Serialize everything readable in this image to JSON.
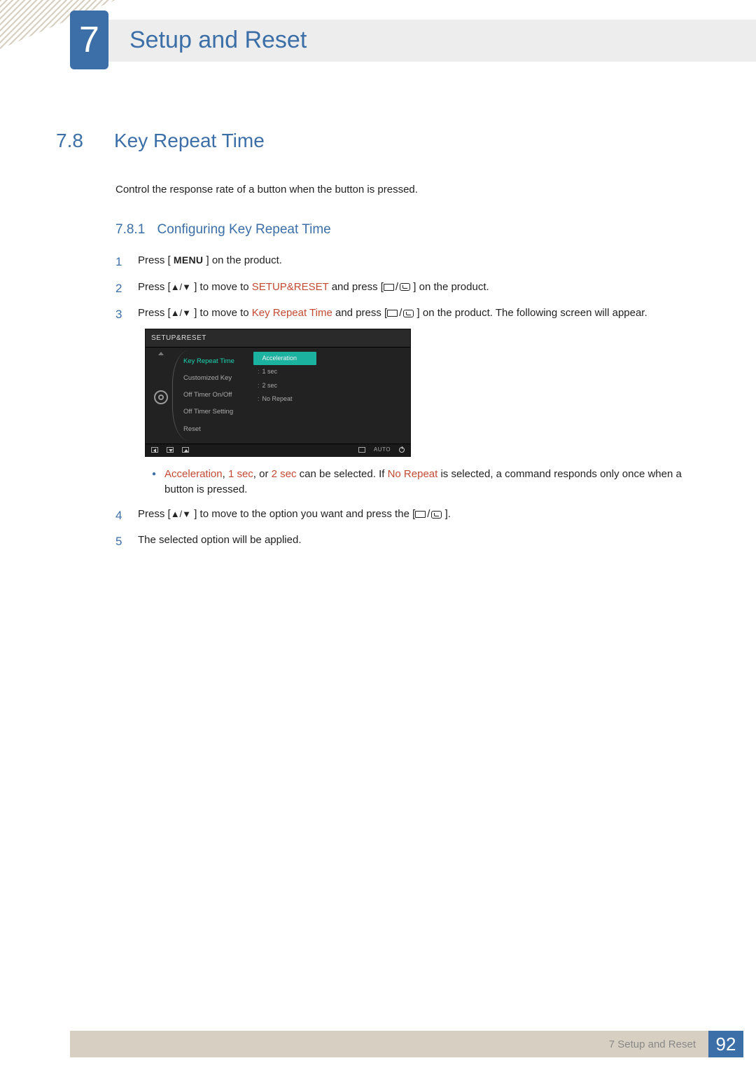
{
  "chapter": {
    "number": "7",
    "title": "Setup and Reset"
  },
  "section": {
    "number": "7.8",
    "title": "Key Repeat Time"
  },
  "intro": "Control the response rate of a button when the button is pressed.",
  "subsection": {
    "number": "7.8.1",
    "title": "Configuring Key Repeat Time"
  },
  "steps": {
    "s1": {
      "num": "1",
      "pre": "Press [",
      "menu": " MENU ",
      "post": "] on the product."
    },
    "s2": {
      "num": "2",
      "pre": "Press [",
      "arrows": "▲/▼",
      "mid": " ] to move to ",
      "target": "SETUP&RESET",
      "after": " and press [",
      "tail": " ] on the product."
    },
    "s3": {
      "num": "3",
      "pre": "Press [",
      "arrows": "▲/▼",
      "mid": " ] to move to ",
      "target": "Key Repeat Time",
      "after": " and press [",
      "tail": " ] on the product. The following screen will appear."
    },
    "s4": {
      "num": "4",
      "pre": "Press [",
      "arrows": "▲/▼",
      "mid": " ] to move to the option you want and press the [",
      "tail": " ]."
    },
    "s5": {
      "num": "5",
      "text": "The selected option will be applied."
    }
  },
  "note": {
    "a": "Acceleration",
    "b": "1 sec",
    "c": "2 sec",
    "mid": " can be selected. If ",
    "d": "No Repeat",
    "tail": " is selected, a command responds only once when a button is pressed."
  },
  "osd": {
    "title": "SETUP&RESET",
    "menu": [
      "Key Repeat Time",
      "Customized Key",
      "Off Timer On/Off",
      "Off Timer Setting",
      "Reset"
    ],
    "options": [
      "Acceleration",
      "1 sec",
      "2 sec",
      "No Repeat"
    ],
    "auto": "AUTO"
  },
  "footer": {
    "text": "7 Setup and Reset",
    "page": "92"
  }
}
